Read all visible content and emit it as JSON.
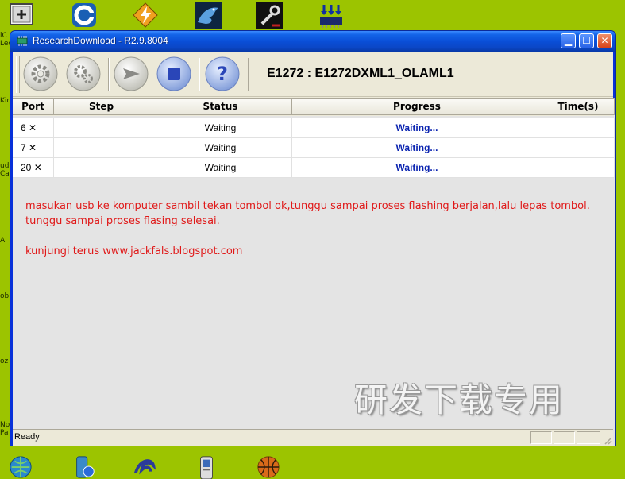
{
  "desktop": {
    "top_icons": [
      "plus-app-icon",
      "ccleaner-icon",
      "winamp-icon",
      "dragon-icon",
      "tools-icon",
      "download-chip-icon"
    ],
    "bottom_icons": [
      "network-globe-icon",
      "phone-sync-icon",
      "swirl-icon",
      "mobile-icon",
      "basketball-icon"
    ],
    "left_labels": [
      "iC",
      "Lec",
      "Kin",
      "ud",
      "Ca",
      "A",
      "ob",
      "oz",
      "No",
      "Pa"
    ]
  },
  "window": {
    "title": "ResearchDownload - R2.9.8004",
    "device_label": "E1272 : E1272DXML1_OLAML1"
  },
  "toolbar": {
    "buttons": [
      "settings-gear-icon",
      "multi-gear-icon",
      "start-arrow-icon",
      "stop-icon",
      "help-icon"
    ]
  },
  "table": {
    "headers": [
      "Port",
      "Step",
      "Status",
      "Progress",
      "Time(s)"
    ],
    "rows": [
      {
        "port": "6",
        "step": "",
        "status": "Waiting",
        "progress": "Waiting...",
        "time": ""
      },
      {
        "port": "7",
        "step": "",
        "status": "Waiting",
        "progress": "Waiting...",
        "time": ""
      },
      {
        "port": "20",
        "step": "",
        "status": "Waiting",
        "progress": "Waiting...",
        "time": ""
      }
    ]
  },
  "message": {
    "line1": "masukan usb ke komputer sambil tekan tombol ok,tunggu sampai proses flashing berjalan,lalu lepas tombol.",
    "line2": "tunggu sampai proses flasing selesai.",
    "line3": "kunjungi terus www.jackfals.blogspot.com"
  },
  "watermark": "研发下载专用",
  "statusbar": {
    "text": "Ready"
  },
  "colors": {
    "desktop": "#9cc400",
    "message": "#e01818",
    "progress": "#0a23b0"
  }
}
